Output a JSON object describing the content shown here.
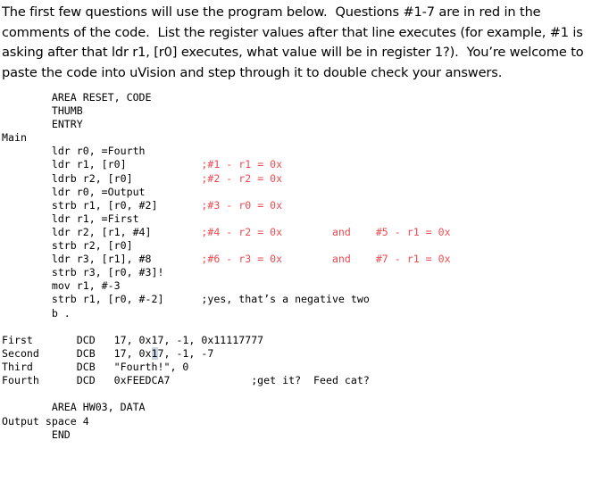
{
  "document": {
    "intro_paragraph": "The first few questions will use the program below.  Questions #1-7 are in red in the comments of the code.  List the register values after that line executes (for example, #1 is asking after that ldr r1, [r0] executes, what value will be in register 1?).  You’re welcome to paste the code into uVision and step through it to double check your answers.",
    "colors": {
      "text": "#000000",
      "comment_red": "#ee4b52",
      "selection_highlight": "#c8d4e4",
      "background": "#ffffff"
    }
  },
  "code_main": {
    "lines": [
      {
        "code": "        AREA RESET, CODE",
        "comment": "",
        "comment_color": ""
      },
      {
        "code": "        THUMB",
        "comment": "",
        "comment_color": ""
      },
      {
        "code": "        ENTRY",
        "comment": "",
        "comment_color": ""
      },
      {
        "code": "Main",
        "comment": "",
        "comment_color": ""
      },
      {
        "code": "        ldr r0, =Fourth",
        "comment": "",
        "comment_color": ""
      },
      {
        "code": "        ldr r1, [r0]",
        "comment": ";#1 - r1 = 0x",
        "comment_color": "red"
      },
      {
        "code": "        ldrb r2, [r0]",
        "comment": ";#2 - r2 = 0x",
        "comment_color": "red"
      },
      {
        "code": "        ldr r0, =Output",
        "comment": "",
        "comment_color": ""
      },
      {
        "code": "        strb r1, [r0, #2]",
        "comment": ";#3 - r0 = 0x",
        "comment_color": "red"
      },
      {
        "code": "        ldr r1, =First",
        "comment": "",
        "comment_color": ""
      },
      {
        "code": "        ldr r2, [r1, #4]",
        "comment": ";#4 - r2 = 0x        and    #5 - r1 = 0x",
        "comment_color": "red"
      },
      {
        "code": "        strb r2, [r0]",
        "comment": "",
        "comment_color": ""
      },
      {
        "code": "        ldr r3, [r1], #8",
        "comment": ";#6 - r3 = 0x        and    #7 - r1 = 0x",
        "comment_color": "red"
      },
      {
        "code": "        strb r3, [r0, #3]!",
        "comment": "",
        "comment_color": ""
      },
      {
        "code": "        mov r1, #-3",
        "comment": "",
        "comment_color": ""
      },
      {
        "code": "        strb r1, [r0, #-2]",
        "comment": ";yes, that’s a negative two",
        "comment_color": "black"
      },
      {
        "code": "        b .",
        "comment": "",
        "comment_color": ""
      }
    ]
  },
  "code_data": {
    "lines": [
      {
        "label": "First",
        "directive": "DCD",
        "value_pre": "17, 0x17, -1, 0x11117777",
        "value_hl": "",
        "value_post": "",
        "comment": "",
        "comment_color": ""
      },
      {
        "label": "Second",
        "directive": "DCB",
        "value_pre": "17, 0x",
        "value_hl": "1",
        "value_post": "7, -1, -7",
        "comment": "",
        "comment_color": ""
      },
      {
        "label": "Third",
        "directive": "DCB",
        "value_pre": "\"Fourth!\", 0",
        "value_hl": "",
        "value_post": "",
        "comment": "",
        "comment_color": ""
      },
      {
        "label": "Fourth",
        "directive": "DCD",
        "value_pre": "0xFEEDCA7",
        "value_hl": "",
        "value_post": "",
        "comment": ";get it?  Feed cat?",
        "comment_color": "black"
      }
    ]
  },
  "code_tail": {
    "lines": [
      {
        "code": "        AREA HW03, DATA"
      },
      {
        "code": "Output space 4"
      },
      {
        "code": "        END"
      }
    ]
  }
}
